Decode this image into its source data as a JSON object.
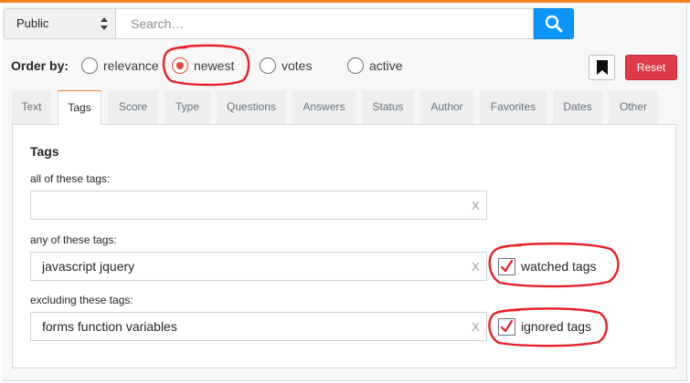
{
  "search": {
    "scope_value": "Public",
    "placeholder": "Search…"
  },
  "order": {
    "label": "Order by:",
    "options": [
      {
        "label": "relevance",
        "checked": false
      },
      {
        "label": "newest",
        "checked": true
      },
      {
        "label": "votes",
        "checked": false
      },
      {
        "label": "active",
        "checked": false
      }
    ]
  },
  "actions": {
    "reset_label": "Reset"
  },
  "tabs": [
    {
      "label": "Text",
      "active": false
    },
    {
      "label": "Tags",
      "active": true
    },
    {
      "label": "Score",
      "active": false
    },
    {
      "label": "Type",
      "active": false
    },
    {
      "label": "Questions",
      "active": false
    },
    {
      "label": "Answers",
      "active": false
    },
    {
      "label": "Status",
      "active": false
    },
    {
      "label": "Author",
      "active": false
    },
    {
      "label": "Favorites",
      "active": false
    },
    {
      "label": "Dates",
      "active": false
    },
    {
      "label": "Other",
      "active": false
    }
  ],
  "tags_panel": {
    "title": "Tags",
    "fields": [
      {
        "label": "all of these tags:",
        "value": "",
        "clear": "X"
      },
      {
        "label": "any of these tags:",
        "value": "javascript jquery",
        "clear": "X",
        "checkbox_label": "watched tags",
        "checked": true
      },
      {
        "label": "excluding these tags:",
        "value": "forms function variables",
        "clear": "X",
        "checkbox_label": "ignored tags",
        "checked": true
      }
    ]
  },
  "colors": {
    "accent": "#f48024",
    "search_button": "#0a95ff",
    "reset_button": "#de3a4a",
    "annotation": "#e8202a"
  },
  "icons": {
    "scope_arrows": "updown-arrows-icon",
    "search": "search-icon",
    "bookmark": "bookmark-icon",
    "checkmark": "checkmark-icon"
  }
}
